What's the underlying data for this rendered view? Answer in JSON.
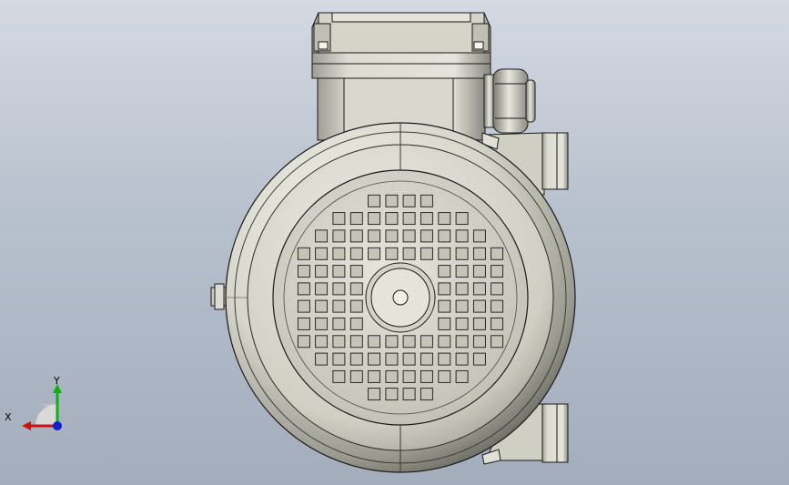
{
  "viewport": {
    "background_top": "#d4d9e2",
    "background_bottom": "#a3adbc"
  },
  "model": {
    "metal_light": "#f2f2ea",
    "metal_mid": "#c9c9bd",
    "metal_dark": "#6b6b63",
    "outline": "#1a1a1a",
    "grille_rows": [
      4,
      8,
      10,
      12,
      12,
      12,
      12,
      12,
      12,
      10,
      8,
      4
    ]
  },
  "triad": {
    "x_label": "X",
    "y_label": "Y",
    "x_color": "#d01010",
    "y_color": "#10b010",
    "z_color": "#1020d0",
    "icon": "coordinate-triad-icon"
  }
}
